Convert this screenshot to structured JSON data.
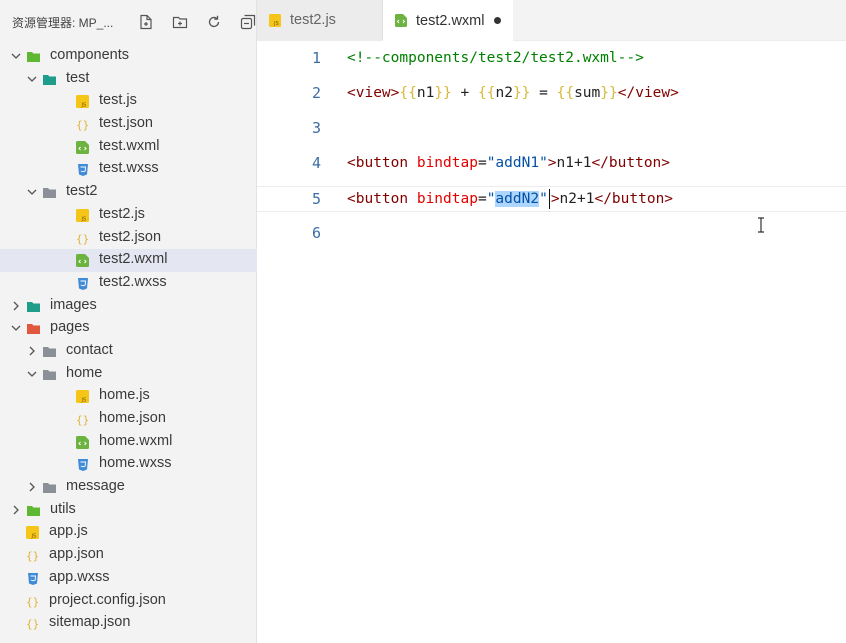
{
  "sidebar": {
    "title": "资源管理器: MP_...",
    "tools": [
      "new-file-icon",
      "new-folder-icon",
      "refresh-icon",
      "collapse-all-icon"
    ],
    "tree": [
      {
        "label": "components",
        "kind": "folder-green",
        "depth": 0,
        "expanded": true
      },
      {
        "label": "test",
        "kind": "folder-teal",
        "depth": 1,
        "expanded": true
      },
      {
        "label": "test.js",
        "kind": "js",
        "depth": 2
      },
      {
        "label": "test.json",
        "kind": "json",
        "depth": 2
      },
      {
        "label": "test.wxml",
        "kind": "wxml",
        "depth": 2
      },
      {
        "label": "test.wxss",
        "kind": "wxss",
        "depth": 2
      },
      {
        "label": "test2",
        "kind": "folder-grey",
        "depth": 1,
        "expanded": true
      },
      {
        "label": "test2.js",
        "kind": "js",
        "depth": 2
      },
      {
        "label": "test2.json",
        "kind": "json",
        "depth": 2
      },
      {
        "label": "test2.wxml",
        "kind": "wxml",
        "depth": 2,
        "selected": true
      },
      {
        "label": "test2.wxss",
        "kind": "wxss",
        "depth": 2
      },
      {
        "label": "images",
        "kind": "folder-teal",
        "depth": 0,
        "expanded": false
      },
      {
        "label": "pages",
        "kind": "folder-red",
        "depth": 0,
        "expanded": true
      },
      {
        "label": "contact",
        "kind": "folder-grey",
        "depth": 1,
        "expanded": false
      },
      {
        "label": "home",
        "kind": "folder-grey",
        "depth": 1,
        "expanded": true
      },
      {
        "label": "home.js",
        "kind": "js",
        "depth": 2
      },
      {
        "label": "home.json",
        "kind": "json",
        "depth": 2
      },
      {
        "label": "home.wxml",
        "kind": "wxml",
        "depth": 2
      },
      {
        "label": "home.wxss",
        "kind": "wxss",
        "depth": 2
      },
      {
        "label": "message",
        "kind": "folder-grey",
        "depth": 1,
        "expanded": false
      },
      {
        "label": "utils",
        "kind": "folder-green",
        "depth": 0,
        "expanded": false
      },
      {
        "label": "app.js",
        "kind": "js",
        "depth": 0,
        "leaf": true
      },
      {
        "label": "app.json",
        "kind": "json",
        "depth": 0,
        "leaf": true
      },
      {
        "label": "app.wxss",
        "kind": "wxss",
        "depth": 0,
        "leaf": true
      },
      {
        "label": "project.config.json",
        "kind": "json",
        "depth": 0,
        "leaf": true
      },
      {
        "label": "sitemap.json",
        "kind": "json",
        "depth": 0,
        "leaf": true
      }
    ]
  },
  "tabs": [
    {
      "label": "test2.js",
      "icon": "js-file-icon",
      "active": false
    },
    {
      "label": "test2.wxml",
      "icon": "wxml-file-icon",
      "active": true,
      "dirty": true
    }
  ],
  "code": [
    {
      "num": "1",
      "tokens": [
        [
          "c-com",
          "<!--components/test2/test2.wxml-->"
        ]
      ]
    },
    {
      "num": "2",
      "tokens": [
        [
          "c-tag",
          "<view>"
        ],
        [
          "c-brc",
          "{{"
        ],
        [
          "c-txt",
          "n1"
        ],
        [
          "c-brc",
          "}}"
        ],
        [
          "c-txt",
          " + "
        ],
        [
          "c-brc",
          "{{"
        ],
        [
          "c-txt",
          "n2"
        ],
        [
          "c-brc",
          "}}"
        ],
        [
          "c-txt",
          " = "
        ],
        [
          "c-brc",
          "{{"
        ],
        [
          "c-txt",
          "sum"
        ],
        [
          "c-brc",
          "}}"
        ],
        [
          "c-tag",
          "</view>"
        ]
      ]
    },
    {
      "num": "3",
      "tokens": []
    },
    {
      "num": "4",
      "tokens": [
        [
          "c-tag",
          "<button"
        ],
        [
          "c-txt",
          " "
        ],
        [
          "c-att",
          "bindtap"
        ],
        [
          "c-txt",
          "="
        ],
        [
          "c-str",
          "\"addN1\""
        ],
        [
          "c-tag",
          ">"
        ],
        [
          "c-txt",
          "n1+1"
        ],
        [
          "c-tag",
          "</button>"
        ]
      ]
    },
    {
      "num": "5",
      "current": true,
      "tokens": [
        [
          "c-tag",
          "<button"
        ],
        [
          "c-txt",
          " "
        ],
        [
          "c-att",
          "bindtap"
        ],
        [
          "c-txt",
          "="
        ],
        [
          "c-str",
          "\""
        ],
        [
          "c-str c-sel",
          "addN2"
        ],
        [
          "c-str",
          "\""
        ],
        [
          "cursor",
          ""
        ],
        [
          "c-tag",
          ">"
        ],
        [
          "c-txt",
          "n2+1"
        ],
        [
          "c-tag",
          "</button>"
        ]
      ]
    },
    {
      "num": "6",
      "tokens": []
    }
  ],
  "colors": {
    "js": "#f5c518",
    "json": "#e0b43a",
    "wxml": "#6db33f",
    "wxss": "#3f8bd8",
    "folder-green": "#5fb832",
    "folder-teal": "#1e9e8a",
    "folder-grey": "#8a8f98",
    "folder-red": "#e2583e"
  }
}
